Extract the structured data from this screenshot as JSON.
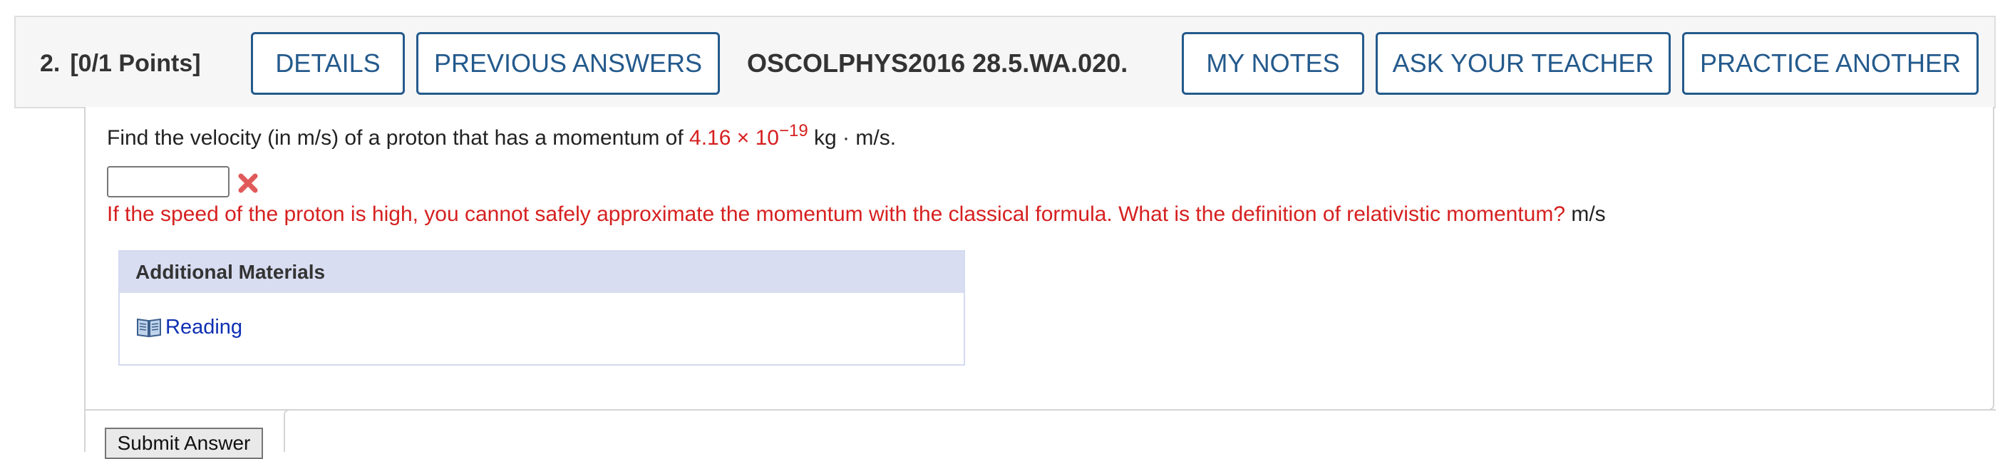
{
  "header": {
    "number": "2.",
    "points": "[0/1 Points]",
    "details_label": "DETAILS",
    "previous_answers_label": "PREVIOUS ANSWERS",
    "question_code": "OSCOLPHYS2016 28.5.WA.020.",
    "my_notes_label": "MY NOTES",
    "ask_teacher_label": "ASK YOUR TEACHER",
    "practice_another_label": "PRACTICE ANOTHER"
  },
  "question": {
    "prompt_before": "Find the velocity (in m/s) of a proton that has a momentum of ",
    "value_mantissa": "4.16 × 10",
    "value_exponent": "−19",
    "prompt_after": " kg · m/s.",
    "answer_value": "",
    "feedback": "If the speed of the proton is high, you cannot safely approximate the momentum with the classical formula. What is the definition of relativistic momentum?",
    "unit": "m/s"
  },
  "materials": {
    "heading": "Additional Materials",
    "reading_label": "Reading"
  },
  "submit_label": "Submit Answer",
  "colors": {
    "accent": "#245a8c",
    "error": "#d62020",
    "link": "#0e2fb3",
    "materials_header": "#d9ddf2"
  },
  "icons": [
    "wrong-answer-icon",
    "book-icon"
  ]
}
